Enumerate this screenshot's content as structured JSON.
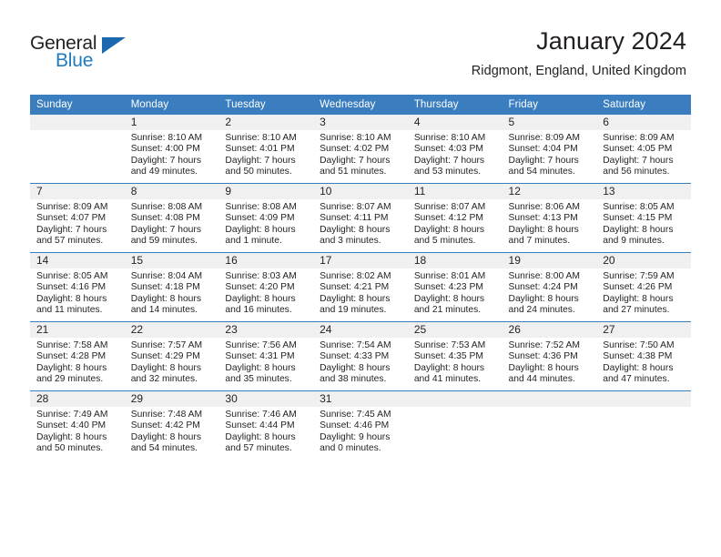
{
  "brand": {
    "name_top": "General",
    "name_bottom": "Blue",
    "color_dark": "#231f20",
    "color_blue": "#1f7bc1",
    "triangle_color": "#1c68ae"
  },
  "header": {
    "title": "January 2024",
    "location": "Ridgmont, England, United Kingdom"
  },
  "theme": {
    "header_row_bg": "#3a7ebf",
    "header_row_text": "#ffffff",
    "daynum_band_bg": "#f0f0f0",
    "cell_bg": "#ffffff",
    "grid_line": "#3a7ebf",
    "text": "#231f20"
  },
  "weekdays": [
    "Sunday",
    "Monday",
    "Tuesday",
    "Wednesday",
    "Thursday",
    "Friday",
    "Saturday"
  ],
  "weeks": [
    [
      {
        "day": ""
      },
      {
        "day": "1",
        "sunrise": "Sunrise: 8:10 AM",
        "sunset": "Sunset: 4:00 PM",
        "daylight_1": "Daylight: 7 hours",
        "daylight_2": "and 49 minutes."
      },
      {
        "day": "2",
        "sunrise": "Sunrise: 8:10 AM",
        "sunset": "Sunset: 4:01 PM",
        "daylight_1": "Daylight: 7 hours",
        "daylight_2": "and 50 minutes."
      },
      {
        "day": "3",
        "sunrise": "Sunrise: 8:10 AM",
        "sunset": "Sunset: 4:02 PM",
        "daylight_1": "Daylight: 7 hours",
        "daylight_2": "and 51 minutes."
      },
      {
        "day": "4",
        "sunrise": "Sunrise: 8:10 AM",
        "sunset": "Sunset: 4:03 PM",
        "daylight_1": "Daylight: 7 hours",
        "daylight_2": "and 53 minutes."
      },
      {
        "day": "5",
        "sunrise": "Sunrise: 8:09 AM",
        "sunset": "Sunset: 4:04 PM",
        "daylight_1": "Daylight: 7 hours",
        "daylight_2": "and 54 minutes."
      },
      {
        "day": "6",
        "sunrise": "Sunrise: 8:09 AM",
        "sunset": "Sunset: 4:05 PM",
        "daylight_1": "Daylight: 7 hours",
        "daylight_2": "and 56 minutes."
      }
    ],
    [
      {
        "day": "7",
        "sunrise": "Sunrise: 8:09 AM",
        "sunset": "Sunset: 4:07 PM",
        "daylight_1": "Daylight: 7 hours",
        "daylight_2": "and 57 minutes."
      },
      {
        "day": "8",
        "sunrise": "Sunrise: 8:08 AM",
        "sunset": "Sunset: 4:08 PM",
        "daylight_1": "Daylight: 7 hours",
        "daylight_2": "and 59 minutes."
      },
      {
        "day": "9",
        "sunrise": "Sunrise: 8:08 AM",
        "sunset": "Sunset: 4:09 PM",
        "daylight_1": "Daylight: 8 hours",
        "daylight_2": "and 1 minute."
      },
      {
        "day": "10",
        "sunrise": "Sunrise: 8:07 AM",
        "sunset": "Sunset: 4:11 PM",
        "daylight_1": "Daylight: 8 hours",
        "daylight_2": "and 3 minutes."
      },
      {
        "day": "11",
        "sunrise": "Sunrise: 8:07 AM",
        "sunset": "Sunset: 4:12 PM",
        "daylight_1": "Daylight: 8 hours",
        "daylight_2": "and 5 minutes."
      },
      {
        "day": "12",
        "sunrise": "Sunrise: 8:06 AM",
        "sunset": "Sunset: 4:13 PM",
        "daylight_1": "Daylight: 8 hours",
        "daylight_2": "and 7 minutes."
      },
      {
        "day": "13",
        "sunrise": "Sunrise: 8:05 AM",
        "sunset": "Sunset: 4:15 PM",
        "daylight_1": "Daylight: 8 hours",
        "daylight_2": "and 9 minutes."
      }
    ],
    [
      {
        "day": "14",
        "sunrise": "Sunrise: 8:05 AM",
        "sunset": "Sunset: 4:16 PM",
        "daylight_1": "Daylight: 8 hours",
        "daylight_2": "and 11 minutes."
      },
      {
        "day": "15",
        "sunrise": "Sunrise: 8:04 AM",
        "sunset": "Sunset: 4:18 PM",
        "daylight_1": "Daylight: 8 hours",
        "daylight_2": "and 14 minutes."
      },
      {
        "day": "16",
        "sunrise": "Sunrise: 8:03 AM",
        "sunset": "Sunset: 4:20 PM",
        "daylight_1": "Daylight: 8 hours",
        "daylight_2": "and 16 minutes."
      },
      {
        "day": "17",
        "sunrise": "Sunrise: 8:02 AM",
        "sunset": "Sunset: 4:21 PM",
        "daylight_1": "Daylight: 8 hours",
        "daylight_2": "and 19 minutes."
      },
      {
        "day": "18",
        "sunrise": "Sunrise: 8:01 AM",
        "sunset": "Sunset: 4:23 PM",
        "daylight_1": "Daylight: 8 hours",
        "daylight_2": "and 21 minutes."
      },
      {
        "day": "19",
        "sunrise": "Sunrise: 8:00 AM",
        "sunset": "Sunset: 4:24 PM",
        "daylight_1": "Daylight: 8 hours",
        "daylight_2": "and 24 minutes."
      },
      {
        "day": "20",
        "sunrise": "Sunrise: 7:59 AM",
        "sunset": "Sunset: 4:26 PM",
        "daylight_1": "Daylight: 8 hours",
        "daylight_2": "and 27 minutes."
      }
    ],
    [
      {
        "day": "21",
        "sunrise": "Sunrise: 7:58 AM",
        "sunset": "Sunset: 4:28 PM",
        "daylight_1": "Daylight: 8 hours",
        "daylight_2": "and 29 minutes."
      },
      {
        "day": "22",
        "sunrise": "Sunrise: 7:57 AM",
        "sunset": "Sunset: 4:29 PM",
        "daylight_1": "Daylight: 8 hours",
        "daylight_2": "and 32 minutes."
      },
      {
        "day": "23",
        "sunrise": "Sunrise: 7:56 AM",
        "sunset": "Sunset: 4:31 PM",
        "daylight_1": "Daylight: 8 hours",
        "daylight_2": "and 35 minutes."
      },
      {
        "day": "24",
        "sunrise": "Sunrise: 7:54 AM",
        "sunset": "Sunset: 4:33 PM",
        "daylight_1": "Daylight: 8 hours",
        "daylight_2": "and 38 minutes."
      },
      {
        "day": "25",
        "sunrise": "Sunrise: 7:53 AM",
        "sunset": "Sunset: 4:35 PM",
        "daylight_1": "Daylight: 8 hours",
        "daylight_2": "and 41 minutes."
      },
      {
        "day": "26",
        "sunrise": "Sunrise: 7:52 AM",
        "sunset": "Sunset: 4:36 PM",
        "daylight_1": "Daylight: 8 hours",
        "daylight_2": "and 44 minutes."
      },
      {
        "day": "27",
        "sunrise": "Sunrise: 7:50 AM",
        "sunset": "Sunset: 4:38 PM",
        "daylight_1": "Daylight: 8 hours",
        "daylight_2": "and 47 minutes."
      }
    ],
    [
      {
        "day": "28",
        "sunrise": "Sunrise: 7:49 AM",
        "sunset": "Sunset: 4:40 PM",
        "daylight_1": "Daylight: 8 hours",
        "daylight_2": "and 50 minutes."
      },
      {
        "day": "29",
        "sunrise": "Sunrise: 7:48 AM",
        "sunset": "Sunset: 4:42 PM",
        "daylight_1": "Daylight: 8 hours",
        "daylight_2": "and 54 minutes."
      },
      {
        "day": "30",
        "sunrise": "Sunrise: 7:46 AM",
        "sunset": "Sunset: 4:44 PM",
        "daylight_1": "Daylight: 8 hours",
        "daylight_2": "and 57 minutes."
      },
      {
        "day": "31",
        "sunrise": "Sunrise: 7:45 AM",
        "sunset": "Sunset: 4:46 PM",
        "daylight_1": "Daylight: 9 hours",
        "daylight_2": "and 0 minutes."
      },
      {
        "day": ""
      },
      {
        "day": ""
      },
      {
        "day": ""
      }
    ]
  ]
}
